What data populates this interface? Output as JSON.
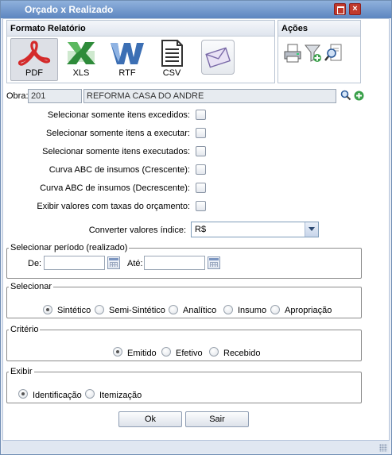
{
  "window": {
    "title": "Orçado x Realizado"
  },
  "formats": {
    "header": "Formato Relatório",
    "items": [
      {
        "label": "PDF",
        "icon": "pdf-icon"
      },
      {
        "label": "XLS",
        "icon": "xls-icon"
      },
      {
        "label": "RTF",
        "icon": "rtf-icon"
      },
      {
        "label": "CSV",
        "icon": "csv-icon"
      }
    ],
    "email_icon": "email-icon"
  },
  "acoes": {
    "header": "Ações",
    "icons": [
      "print-icon",
      "filter-add-icon",
      "search-report-icon"
    ]
  },
  "obra": {
    "label": "Obra:",
    "code": "201",
    "name": "REFORMA CASA DO ANDRE"
  },
  "options": [
    {
      "label": "Selecionar somente itens excedidos:",
      "checked": false
    },
    {
      "label": "Selecionar somente itens a executar:",
      "checked": false
    },
    {
      "label": "Selecionar somente itens executados:",
      "checked": false
    },
    {
      "label": "Curva ABC de insumos (Crescente):",
      "checked": false
    },
    {
      "label": "Curva ABC de insumos (Decrescente):",
      "checked": false
    },
    {
      "label": "Exibir valores com taxas do orçamento:",
      "checked": false
    }
  ],
  "converter": {
    "label": "Converter valores índice:",
    "value": "R$"
  },
  "periodo": {
    "legend": "Selecionar período (realizado)",
    "de_label": "De:",
    "de_value": "",
    "ate_label": "Até:",
    "ate_value": ""
  },
  "selecionar": {
    "legend": "Selecionar",
    "options": [
      "Sintético",
      "Semi-Sintético",
      "Analítico",
      "Insumo",
      "Apropriação"
    ],
    "selected": "Sintético"
  },
  "criterio": {
    "legend": "Critério",
    "options": [
      "Emitido",
      "Efetivo",
      "Recebido"
    ],
    "selected": "Emitido"
  },
  "exibir": {
    "legend": "Exibir",
    "options": [
      "Identificação",
      "Itemização"
    ],
    "selected": "Identificação"
  },
  "buttons": {
    "ok": "Ok",
    "sair": "Sair"
  },
  "colors": {
    "titlebar": "#6e93c8",
    "border": "#6f8db3",
    "pdf": "#d42a2a",
    "xls": "#2e8b3a",
    "rtf": "#3c6fb4"
  }
}
